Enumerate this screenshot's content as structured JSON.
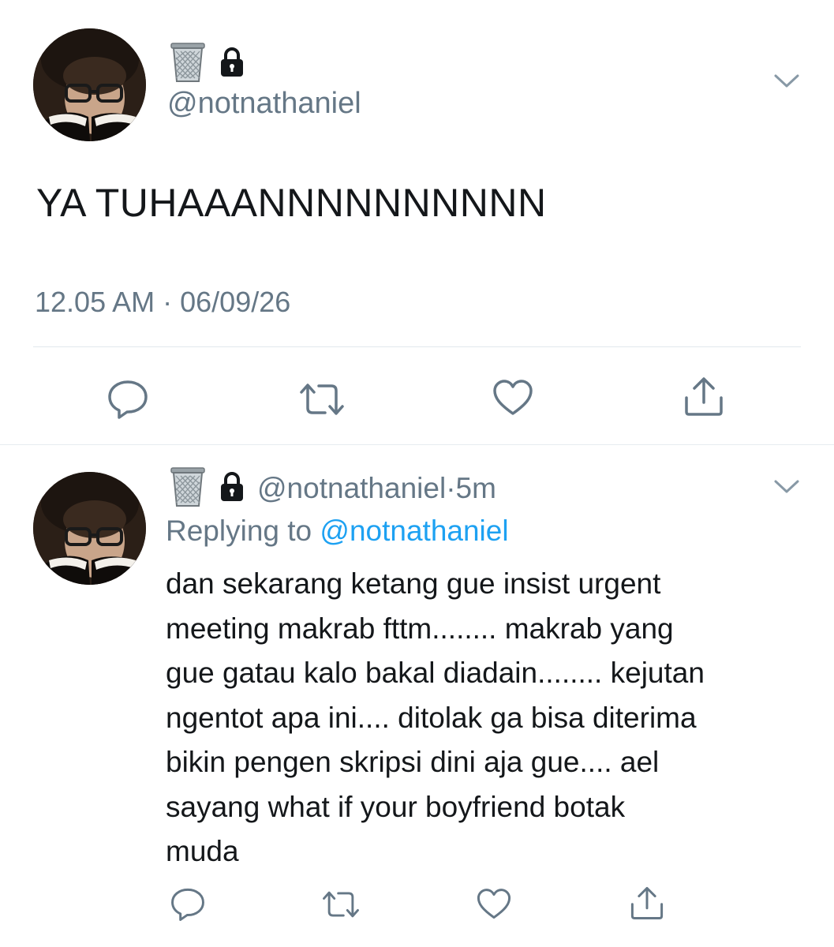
{
  "main_tweet": {
    "display_name_emoji": "wastebasket",
    "protected": true,
    "handle": "@notnathaniel",
    "text": "YA TUHAAANNNNNNNNNN",
    "time": "12.05 AM",
    "separator": "·",
    "date": "06/09/26",
    "actions": {
      "reply_icon": "reply-icon",
      "retweet_icon": "retweet-icon",
      "like_icon": "heart-icon",
      "share_icon": "share-icon"
    }
  },
  "reply_tweet": {
    "display_name_emoji": "wastebasket",
    "protected": true,
    "handle": "@notnathaniel",
    "dot": "·",
    "age": "5m",
    "replying_prefix": "Replying to",
    "replying_to": "@notnathaniel",
    "lines": [
      "dan sekarang ketang gue insist urgent",
      "meeting makrab fttm........ makrab yang",
      "gue gatau kalo bakal diadain........ kejutan",
      "ngentot apa ini.... ditolak ga bisa diterima",
      "bikin pengen skripsi dini aja gue.... ael",
      "sayang what if your boyfriend botak",
      "muda"
    ]
  },
  "colors": {
    "text": "#14171a",
    "secondary": "#657786",
    "link": "#1da1f2",
    "divider": "#e1e8ed",
    "icon": "#657786"
  }
}
